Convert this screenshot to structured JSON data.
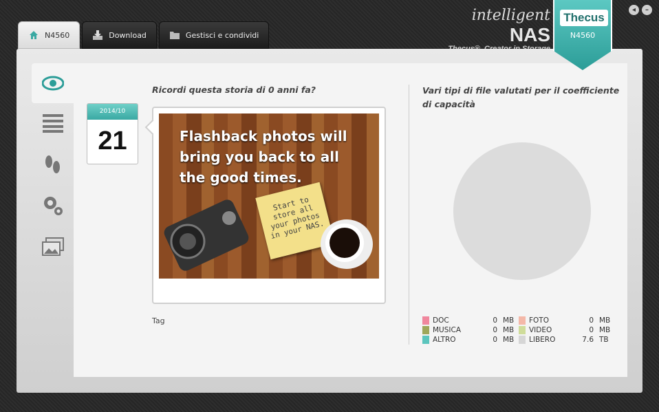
{
  "tabs": [
    {
      "label": "N4560",
      "icon": "home-icon"
    },
    {
      "label": "Download",
      "icon": "download-icon"
    },
    {
      "label": "Gestisci e condividi",
      "icon": "folder-icon"
    }
  ],
  "brand": {
    "title_prefix": "intelligent",
    "title_main": "NAS",
    "tagline": "Thecus®, Creator in Storage",
    "logo": "Thecus",
    "model": "N4560"
  },
  "window": {
    "back_label": "◂",
    "minimize_label": "–"
  },
  "sidebar": [
    {
      "name": "view-icon",
      "active": true
    },
    {
      "name": "list-icon"
    },
    {
      "name": "footprints-icon"
    },
    {
      "name": "gears-icon"
    },
    {
      "name": "gallery-icon"
    }
  ],
  "story": {
    "title": "Ricordi questa storia di 0 anni fa?",
    "calendar_month": "2014/10",
    "calendar_day": "21",
    "photo_text": "Flashback photos will bring you back to all the good times.",
    "sticky_text": "Start to store all your photos in your NAS.",
    "tag_label": "Tag"
  },
  "types": {
    "title": "Vari tipi di file valutati per il coefficiente di capacità",
    "legend": [
      {
        "name": "DOC",
        "value": "0",
        "unit": "MB",
        "color": "#f0879d"
      },
      {
        "name": "FOTO",
        "value": "0",
        "unit": "MB",
        "color": "#f4b8a8"
      },
      {
        "name": "MUSICA",
        "value": "0",
        "unit": "MB",
        "color": "#9fa75a"
      },
      {
        "name": "VIDEO",
        "value": "0",
        "unit": "MB",
        "color": "#cfdc9a"
      },
      {
        "name": "ALTRO",
        "value": "0",
        "unit": "MB",
        "color": "#5cc5bd"
      },
      {
        "name": "LIBERO",
        "value": "7.6",
        "unit": "TB",
        "color": "#d6d6d6"
      }
    ]
  }
}
